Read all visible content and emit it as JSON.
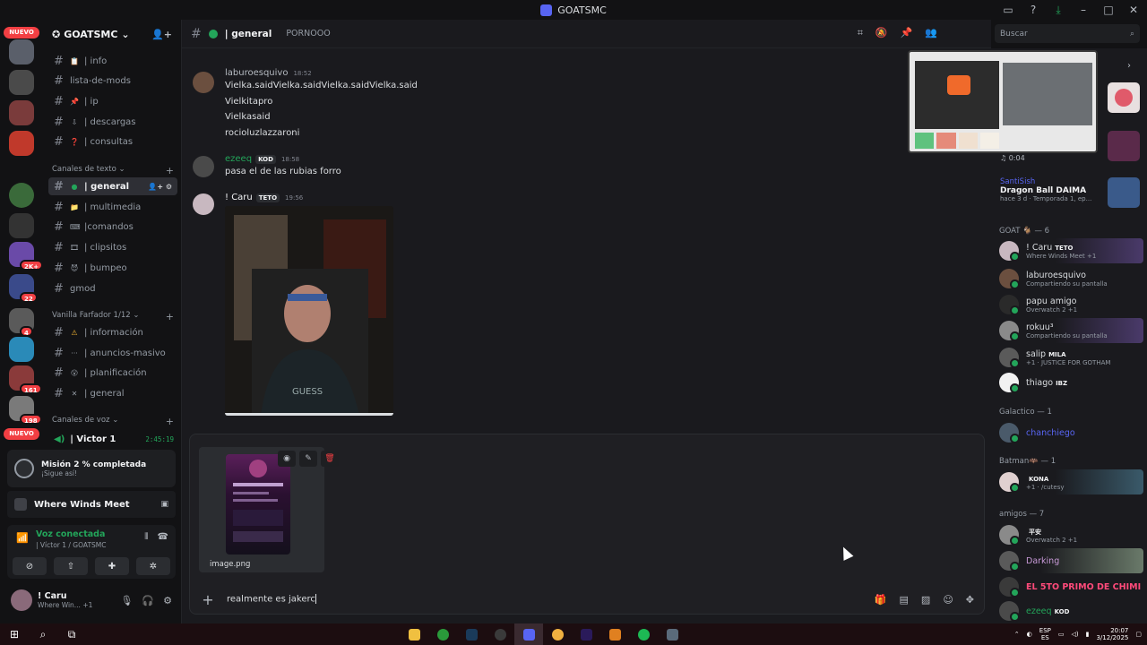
{
  "window": {
    "title": "GOATSMC"
  },
  "server": {
    "name": "GOATSMC"
  },
  "rail": {
    "badges": [
      "NUEVO",
      "2K+",
      "22",
      "161",
      "198",
      "NUEVO",
      "4"
    ]
  },
  "channels_top": [
    {
      "icon": "📋",
      "label": "| info"
    },
    {
      "icon": "",
      "label": "lista-de-mods"
    },
    {
      "icon": "📌",
      "label": "| ip"
    },
    {
      "icon": "⇩",
      "label": "| descargas"
    },
    {
      "icon": "❓",
      "label": "| consultas"
    }
  ],
  "cat_text": "Canales de texto",
  "channels_text": [
    {
      "icon": "●",
      "label": "| general"
    },
    {
      "icon": "📁",
      "label": "| multimedia"
    },
    {
      "icon": "⌨",
      "label": "|comandos"
    },
    {
      "icon": "🎞",
      "label": "| clipsitos"
    },
    {
      "icon": "😈",
      "label": "| bumpeo"
    },
    {
      "icon": "",
      "label": "gmod"
    }
  ],
  "cat_vanilla": "Vanilla Farfador 1/12",
  "channels_vanilla": [
    {
      "icon": "⚠",
      "label": "| información"
    },
    {
      "icon": "···",
      "label": "| anuncios-masivo"
    },
    {
      "icon": "😮",
      "label": "| planificación"
    },
    {
      "icon": "✕",
      "label": "| general"
    }
  ],
  "cat_voice": "Canales de voz",
  "voice_channel": {
    "label": "| Victor 1",
    "time": "2:45:19"
  },
  "mission": {
    "title": "Misión 2 % completada",
    "sub": "¡Sigue así!"
  },
  "game": {
    "name": "Where Winds Meet"
  },
  "voice": {
    "status": "Voz conectada",
    "detail": "| Víctor 1 / GOATSMC"
  },
  "user": {
    "name": "! Caru",
    "status": "Where Win...",
    "extra": "+1"
  },
  "chat": {
    "channel": "| general",
    "topic": "PORNOOO",
    "messages": [
      {
        "author": "laburoesquivo",
        "time": "18:52",
        "lines": [
          "Vielka.saidVielka.saidVielka.saidVielka.said",
          "Vielkitapro",
          "Vielkasaid",
          "rocioluzlazzaroni"
        ]
      },
      {
        "author": "ezeeq",
        "tag": "KOD",
        "time": "18:58",
        "lines": [
          "pasa el de las rubias forro"
        ]
      },
      {
        "author": "! Caru",
        "tag": "TETO",
        "time": "19:56",
        "lines": []
      }
    ],
    "attachment": {
      "filename": "image.png"
    },
    "input_value": "realmente es jakerc"
  },
  "search": {
    "placeholder": "Buscar"
  },
  "activity": {
    "timer": "0:04",
    "user": "SantiSish",
    "title": "Dragon Ball DAIMA",
    "sub": "hace 3 d · Temporada 1, ep..."
  },
  "groups": [
    {
      "label": "GOAT 🐐 — 6"
    },
    {
      "label": "Galactico — 1"
    },
    {
      "label": "Batman🦇 — 1"
    },
    {
      "label": "amigos — 7"
    }
  ],
  "members": [
    {
      "name": "! Caru",
      "tag": "TETO",
      "status": "Where Winds Meet +1"
    },
    {
      "name": "laburoesquivo",
      "tag": "",
      "status": "Compartiendo su pantalla"
    },
    {
      "name": "papu amigo",
      "tag": "",
      "status": "Overwatch 2 +1"
    },
    {
      "name": "rokuu³",
      "tag": "",
      "status": "Compartiendo su pantalla"
    },
    {
      "name": "salip",
      "tag": "MILA",
      "status": "+1 · JUSTICE FOR GOTHAM"
    },
    {
      "name": "thiago",
      "tag": "IBZ",
      "status": ""
    },
    {
      "name": "chanchiego",
      "tag": "",
      "status": ""
    },
    {
      "name": "",
      "tag": "KONA",
      "status": "+1 · /cutesy"
    },
    {
      "name": "",
      "tag": "平安",
      "status": "Overwatch 2 +1"
    },
    {
      "name": "Darking",
      "tag": "",
      "status": ""
    },
    {
      "name": "EL 5TO PRIMO DE CHIMI",
      "tag": "",
      "status": ""
    },
    {
      "name": "ezeeq",
      "tag": "KOD",
      "status": ""
    }
  ],
  "taskbar": {
    "lang1": "ESP",
    "lang2": "ES",
    "time": "20:07",
    "date": "3/12/2025"
  },
  "colors": {
    "accent": "#5865f2",
    "online": "#23a55a",
    "danger": "#f23f43"
  }
}
